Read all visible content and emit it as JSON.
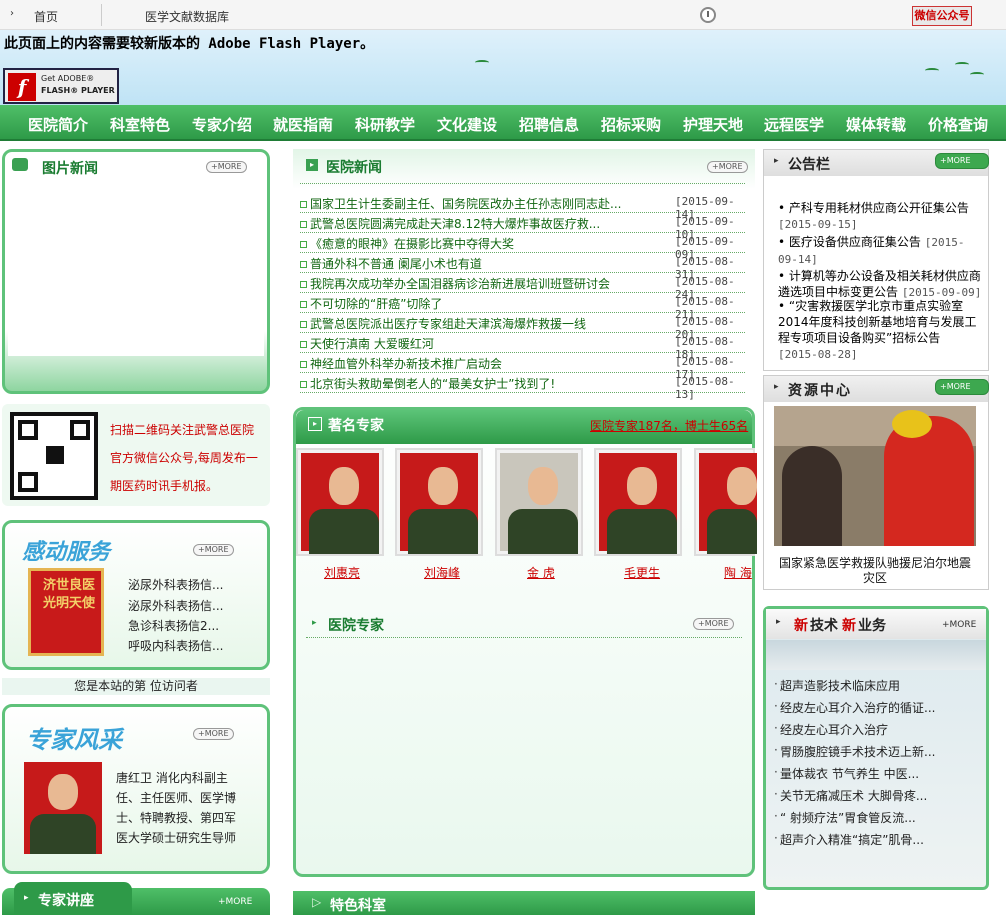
{
  "topbar": {
    "home": "首页",
    "database": "医学文献数据库",
    "wechat": "微信公众号"
  },
  "banner": {
    "flash_notice": "此页面上的内容需要较新版本的 Adobe Flash Player。",
    "badge_get": "Get ADOBE®",
    "badge_flash": "FLASH® PLAYER"
  },
  "nav": [
    "医院简介",
    "科室特色",
    "专家介绍",
    "就医指南",
    "科研教学",
    "文化建设",
    "招聘信息",
    "招标采购",
    "护理天地",
    "远程医学",
    "媒体转载",
    "价格查询"
  ],
  "more_label": "+MORE",
  "photo_news": {
    "title": "图片新闻"
  },
  "qr": {
    "text": "扫描二维码关注武警总医院官方微信公众号,每周发布一期医药时讯手机报。"
  },
  "touching": {
    "title": "感动服务",
    "banner_text": "济世良医 光明天使",
    "items": [
      "泌尿外科表扬信...",
      "泌尿外科表扬信...",
      "急诊科表扬信2...",
      "呼吸内科表扬信..."
    ]
  },
  "visitor": {
    "text": "您是本站的第 位访问者"
  },
  "expert_style": {
    "title": "专家风采",
    "text": "唐红卫 消化内科副主任、主任医师、医学博士、特聘教授、第四军医大学硕士研究生导师"
  },
  "expert_lecture": {
    "title": "专家讲座"
  },
  "hospital_news": {
    "title": "医院新闻",
    "items": [
      {
        "t": "国家卫生计生委副主任、国务院医改办主任孙志刚同志赴...",
        "d": "[2015-09-14]"
      },
      {
        "t": "武警总医院圆满完成赴天津8.12特大爆炸事故医疗救...",
        "d": "[2015-09-10]"
      },
      {
        "t": "《癒意的眼神》在摄影比赛中夺得大奖",
        "d": "[2015-09-09]"
      },
      {
        "t": "普通外科不普通 阑尾小术也有道",
        "d": "[2015-08-31]"
      },
      {
        "t": "我院再次成功举办全国泪器病诊治新进展培训班暨研讨会",
        "d": "[2015-08-24]"
      },
      {
        "t": "不可切除的“肝癌”切除了",
        "d": "[2015-08-21]"
      },
      {
        "t": "武警总医院派出医疗专家组赴天津滨海爆炸救援一线",
        "d": "[2015-08-20]"
      },
      {
        "t": "天使行滇南 大爱暖红河",
        "d": "[2015-08-18]"
      },
      {
        "t": "神经血管外科举办新技术推广启动会",
        "d": "[2015-08-17]"
      },
      {
        "t": "北京街头救助晕倒老人的“最美女护士”找到了!",
        "d": "[2015-08-13]"
      }
    ]
  },
  "famous": {
    "title": "著名专家",
    "count": "医院专家187名，博士生65名",
    "names": [
      "刘惠亮",
      "刘海峰",
      "金 虎",
      "毛更生",
      "陶 海"
    ]
  },
  "hospital_experts": {
    "title": "医院专家"
  },
  "featured_dept": {
    "title": "特色科室"
  },
  "notice": {
    "title": "公告栏",
    "items": [
      {
        "t": "产科专用耗材供应商公开征集公告",
        "d": "[2015-09-15]"
      },
      {
        "t": "医疗设备供应商征集公告",
        "d": "[2015-09-14]"
      },
      {
        "t": "计算机等办公设备及相关耗材供应商遴选项目中标变更公告",
        "d": "[2015-09-09]"
      },
      {
        "t": "“灾害救援医学北京市重点实验室2014年度科技创新基地培育与发展工程专项项目设备购买”招标公告",
        "d": "[2015-08-28]"
      }
    ]
  },
  "resource": {
    "title": "资源中心",
    "caption": "国家紧急医学救援队驰援尼泊尔地震灾区"
  },
  "newtech": {
    "title_a": "新",
    "title_b": "技术",
    "title_c": "新",
    "title_d": "业务",
    "items": [
      "超声造影技术临床应用",
      "经皮左心耳介入治疗的循证...",
      "经皮左心耳介入治疗",
      "胃肠腹腔镜手术技术迈上新...",
      "量体裁衣 节气养生 中医...",
      "关节无痛减压术 大脚骨疼...",
      "“ 射频疗法”胃食管反流...",
      "超声介入精准“搞定”肌骨..."
    ]
  }
}
